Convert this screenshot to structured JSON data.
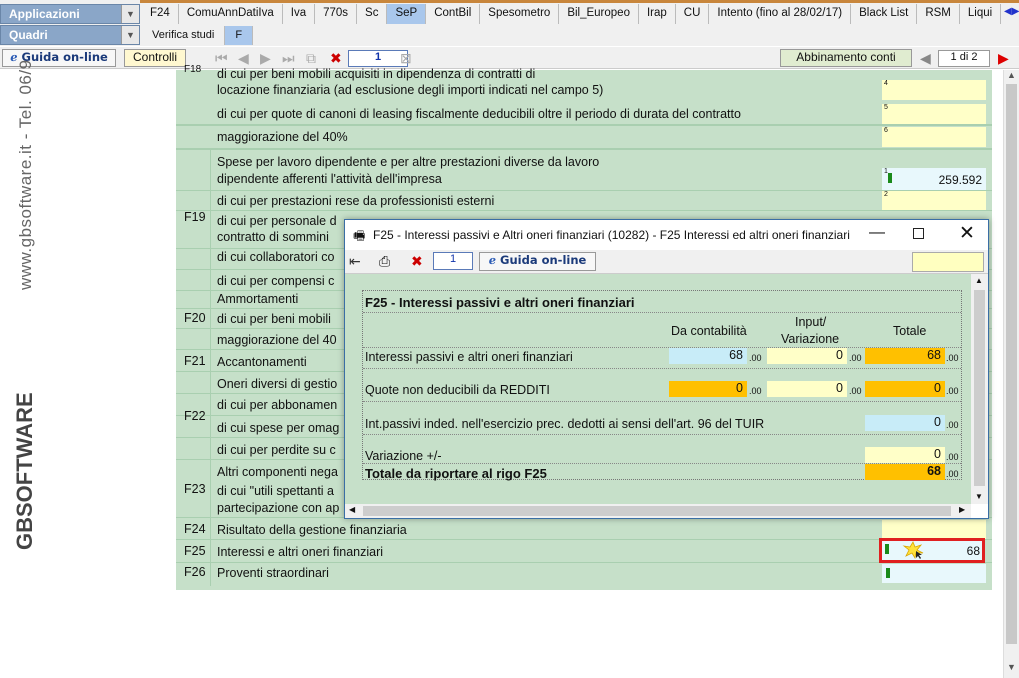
{
  "top": {
    "applicazioni": "Applicazioni",
    "quadri": "Quadri",
    "tabs": [
      "F24",
      "ComuAnnDatiIva",
      "Iva",
      "770s",
      "Sc",
      "SeP",
      "ContBil",
      "Spesometro",
      "Bil_Europeo",
      "Irap",
      "CU",
      "Intento (fino al 28/02/17)",
      "Black List",
      "RSM",
      "Liqui"
    ],
    "active_tab": "SeP",
    "subtabs": [
      "Verifica studi",
      "F"
    ],
    "active_subtab": "F"
  },
  "toolbar": {
    "guida": "Guida on-line",
    "controlli": "Controlli",
    "page": "1",
    "abbinamento": "Abbinamento conti",
    "pages": "1 di 2"
  },
  "brand": {
    "site": "www.gbsoftware.it - Tel. 06/9",
    "logo": "GBSOFTWARE"
  },
  "form": {
    "F18_label": "F18",
    "r1": "di cui per beni mobili acquisiti in dipendenza di contratti di",
    "r1b": "locazione finanziaria (ad esclusione degli importi indicati nel campo 5)",
    "r2": "di cui per quote di canoni di leasing fiscalmente deducibili oltre il periodo di durata del contratto",
    "r3": "maggiorazione del 40%",
    "F19": "F19",
    "r4": "Spese per lavoro dipendente e per altre prestazioni diverse da lavoro",
    "r4b": "dipendente afferenti l'attività dell'impresa",
    "r5": "di cui per prestazioni rese da professionisti esterni",
    "r6": "di cui per personale d",
    "r6b": "contratto di sommini",
    "r7": "di cui collaboratori co",
    "r8": "di cui per compensi c",
    "F20": "F20",
    "r9": "Ammortamenti",
    "r10": "di cui per beni mobili",
    "r11": "maggiorazione del 40",
    "F21": "F21",
    "r12": "Accantonamenti",
    "F22": "F22",
    "r13": "Oneri diversi di gestio",
    "r14": "di cui per abbonamen",
    "r15": "di cui spese per omag",
    "r16": "di cui per perdite su c",
    "F23": "F23",
    "r17": "Altri componenti nega",
    "r18": "di cui \"utili spettanti a",
    "r18b": "partecipazione con ap",
    "F24": "F24",
    "r19": "Risultato della gestione finanziaria",
    "F25": "F25",
    "r20": "Interessi e altri oneri finanziari",
    "F26": "F26",
    "r21": "Proventi straordinari",
    "field_nums": {
      "n4": "4",
      "n5": "5",
      "n6": "6",
      "n1": "1",
      "n2": "2"
    },
    "spese_value": "259.592",
    "f25_value": "68"
  },
  "dialog": {
    "title": "F25 - Interessi passivi e Altri oneri finanziari (10282) - F25 Interessi ed altri oneri finanziari",
    "page": "1",
    "guida": "Guida on-line",
    "heading": "F25 - Interessi passivi e altri oneri finanziari",
    "col1": "Da contabilità",
    "col2a": "Input/",
    "col2b": "Variazione",
    "col3": "Totale",
    "row1": "Interessi passivi e altri oneri finanziari",
    "row1_v1": "68",
    "row1_v2": "0",
    "row1_v3": "68",
    "row2": "Quote non deducibili da REDDITI",
    "row2_v1": "0",
    "row2_v2": "0",
    "row2_v3": "0",
    "row3": "Int.passivi inded. nell'esercizio prec. dedotti ai sensi dell'art. 96 del TUIR",
    "row3_v3": "0",
    "row4": "Variazione +/-",
    "row4_v3": "0",
    "row5": "Totale da riportare al rigo F25",
    "row5_v3": "68",
    "dec": ".00"
  },
  "colors": {
    "green": "#c6e0c9",
    "yellow": "#ffffc8",
    "orange": "#ffc000",
    "lightblue": "#c8ecf8",
    "highlight": "#e02020"
  }
}
